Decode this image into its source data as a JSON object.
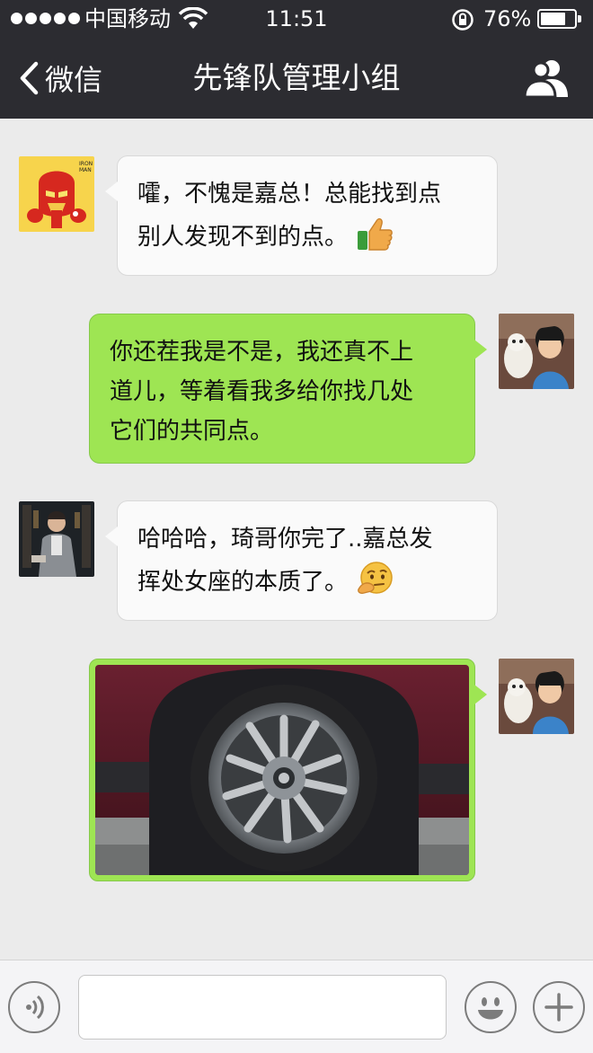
{
  "status_bar": {
    "carrier": "中国移动",
    "time": "11:51",
    "battery_percent": "76%",
    "battery_level": 0.76
  },
  "nav": {
    "back_label": "微信",
    "title": "先锋队管理小组"
  },
  "messages": [
    {
      "side": "left",
      "text": "嚯，不愧是嘉总！总能找到点\n别人发现不到的点。",
      "emoji": "thumbs-up"
    },
    {
      "side": "right",
      "text": "你还茬我是不是，我还真不上\n道儿，等着看我多给你找几处\n它们的共同点。"
    },
    {
      "side": "left",
      "text": "哈哈哈，琦哥你完了..嘉总发\n挥处女座的本质了。",
      "emoji": "thinking-face"
    },
    {
      "side": "right",
      "image": "car-wheel-photo"
    }
  ],
  "avatars": {
    "sender_1_badge": "IRON MAN"
  },
  "colors": {
    "nav_background": "#2c2c31",
    "chat_background": "#ebebeb",
    "outgoing_bubble": "#9ee553",
    "incoming_bubble": "#fafafa"
  }
}
